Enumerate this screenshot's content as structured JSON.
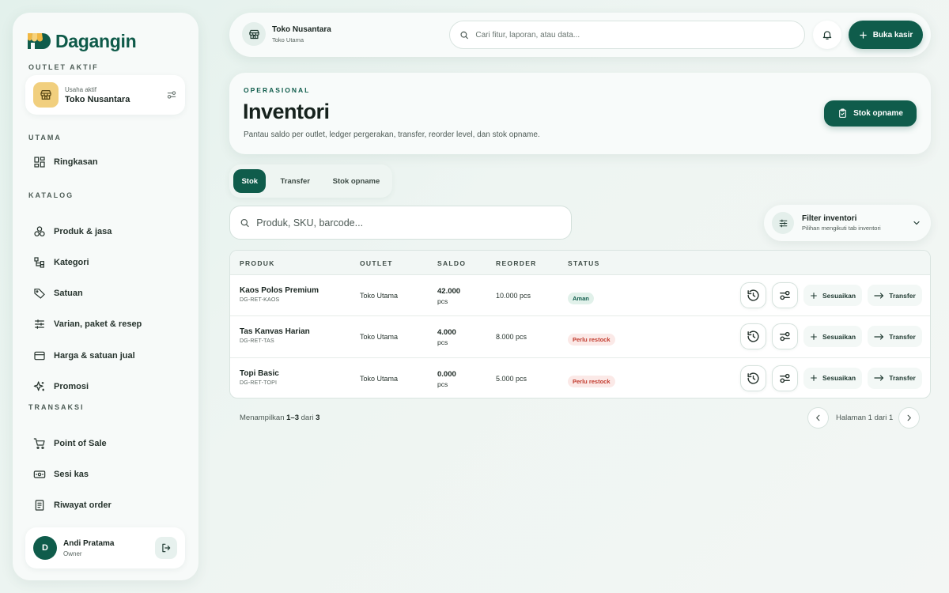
{
  "brand": {
    "name": "Dagangin"
  },
  "sidebar": {
    "outlet_section": "OUTLET AKTIF",
    "outlet_sub": "Usaha aktif",
    "outlet_name": "Toko Nusantara",
    "sections": {
      "utama": "UTAMA",
      "katalog": "KATALOG",
      "transaksi": "TRANSAKSI"
    },
    "items": [
      {
        "label": "Ringkasan",
        "icon": "grid-icon"
      },
      {
        "label": "Produk & jasa",
        "icon": "boxes-icon"
      },
      {
        "label": "Kategori",
        "icon": "tree-icon"
      },
      {
        "label": "Satuan",
        "icon": "tag-icon"
      },
      {
        "label": "Varian, paket & resep",
        "icon": "sliders-icon"
      },
      {
        "label": "Harga & satuan jual",
        "icon": "card-icon"
      },
      {
        "label": "Promosi",
        "icon": "sparkle-icon"
      },
      {
        "label": "Point of Sale",
        "icon": "cart-icon"
      },
      {
        "label": "Sesi kas",
        "icon": "cash-icon"
      },
      {
        "label": "Riwayat order",
        "icon": "receipt-icon"
      }
    ],
    "user": {
      "initial": "D",
      "name": "Andi Pratama",
      "role": "Owner"
    }
  },
  "topbar": {
    "store_name": "Toko Nusantara",
    "store_sub": "Toko Utama",
    "search_placeholder": "Cari fitur, laporan, atau data...",
    "open_cashier": "Buka kasir"
  },
  "header": {
    "eyebrow": "OPERASIONAL",
    "title": "Inventori",
    "description": "Pantau saldo per outlet, ledger pergerakan, transfer, reorder level, dan stok opname.",
    "stock_opname_button": "Stok opname"
  },
  "tabs": [
    {
      "label": "Stok",
      "active": true
    },
    {
      "label": "Transfer",
      "active": false
    },
    {
      "label": "Stok opname",
      "active": false
    }
  ],
  "search": {
    "placeholder": "Produk, SKU, barcode..."
  },
  "filter": {
    "title": "Filter inventori",
    "subtitle": "Pilihan mengikuti tab inventori"
  },
  "table": {
    "headers": {
      "product": "PRODUK",
      "outlet": "OUTLET",
      "saldo": "SALDO",
      "reorder": "REORDER",
      "status": "STATUS"
    },
    "action_adjust": "Sesuaikan",
    "action_transfer": "Transfer",
    "rows": [
      {
        "name": "Kaos Polos Premium",
        "sku": "DG-RET-KAOS",
        "outlet": "Toko Utama",
        "qty": "42.000",
        "unit": "pcs",
        "reorder": "10.000 pcs",
        "status": "Aman"
      },
      {
        "name": "Tas Kanvas Harian",
        "sku": "DG-RET-TAS",
        "outlet": "Toko Utama",
        "qty": "4.000",
        "unit": "pcs",
        "reorder": "8.000 pcs",
        "status": "Perlu restock"
      },
      {
        "name": "Topi Basic",
        "sku": "DG-RET-TOPI",
        "outlet": "Toko Utama",
        "qty": "0.000",
        "unit": "pcs",
        "reorder": "5.000 pcs",
        "status": "Perlu restock"
      }
    ]
  },
  "footer": {
    "showing_prefix": "Menampilkan",
    "showing_range": "1–3",
    "showing_mid": "dari",
    "showing_total": "3",
    "page_label": "Halaman 1 dari 1"
  },
  "colors": {
    "primary": "#0f5c4b",
    "ok_bg": "#e1f1ea",
    "warn_text": "#c23b2e",
    "warn_bg": "#fbe9e7",
    "outlet_icon_bg": "#f1cf7e"
  }
}
